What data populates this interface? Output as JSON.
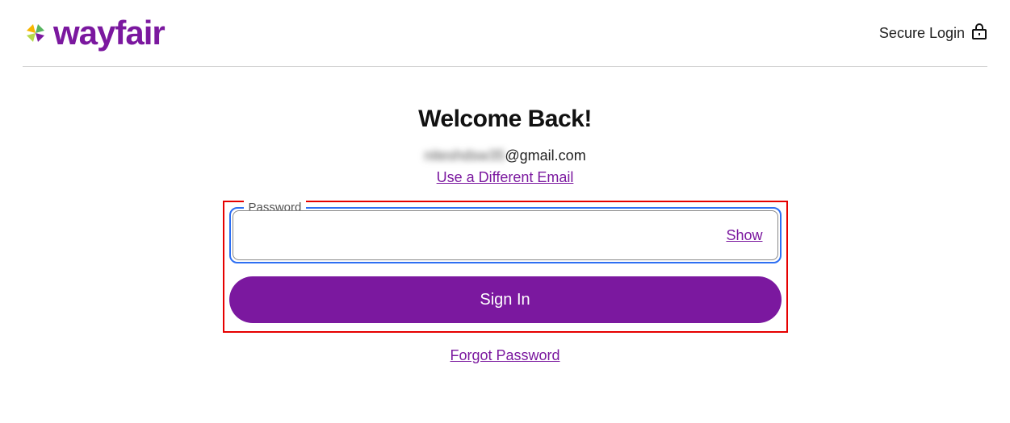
{
  "header": {
    "brand_name": "wayfair",
    "secure_label": "Secure Login"
  },
  "main": {
    "title": "Welcome Back!",
    "email_obscured": "niteshdsw35",
    "email_domain": "@gmail.com",
    "different_email_link": "Use a Different Email",
    "password_label": "Password",
    "password_value": "",
    "show_label": "Show",
    "signin_label": "Sign In",
    "forgot_link": "Forgot Password"
  },
  "colors": {
    "brand_purple": "#7b189f",
    "focus_blue": "#2e6ff2",
    "highlight_red": "#e60000"
  }
}
